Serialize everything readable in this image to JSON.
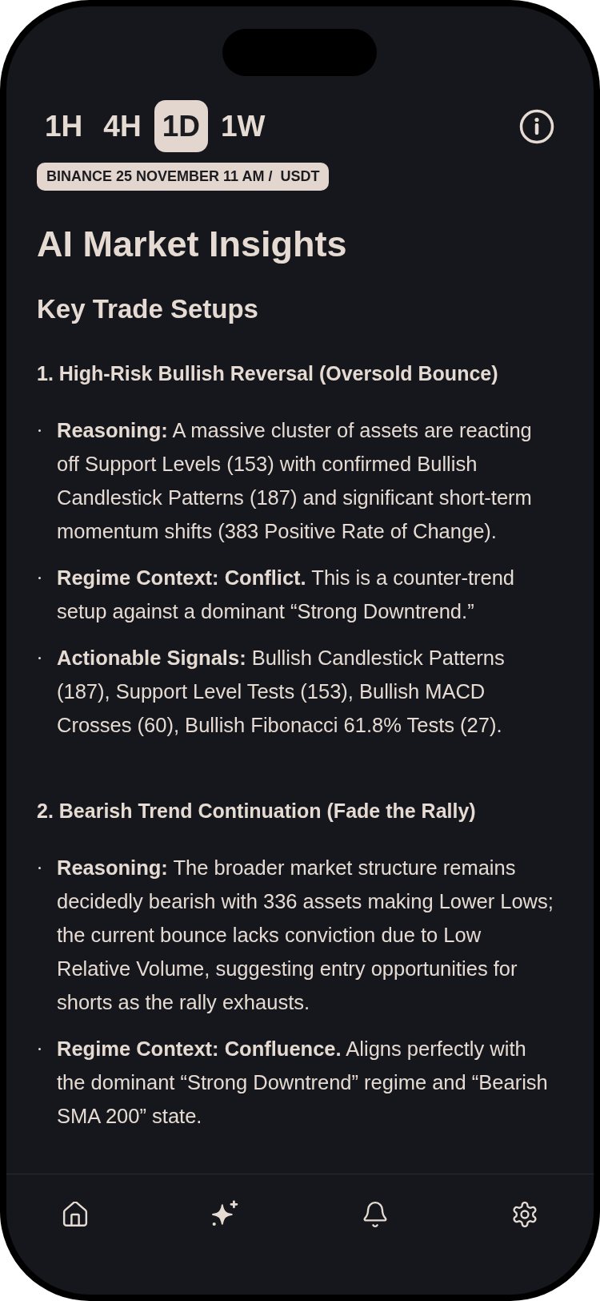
{
  "timeframe_tabs": [
    {
      "label": "1H",
      "selected": false
    },
    {
      "label": "4H",
      "selected": false
    },
    {
      "label": "1D",
      "selected": true
    },
    {
      "label": "1W",
      "selected": false
    }
  ],
  "source_badge": "BINANCE 25 NOVEMBER 11 AM /  USDT",
  "title": "AI Market Insights",
  "subtitle": "Key Trade Setups",
  "setups": [
    {
      "heading": "1. High-Risk Bullish Reversal (Oversold Bounce)",
      "points": [
        "**Reasoning:** A massive cluster of assets are reacting off Support Levels (153) with confirmed Bullish Candlestick Patterns (187) and significant short-term momentum shifts (383 Positive Rate of Change).",
        "**Regime Context: Conflict.** This is a counter-trend setup against a dominant “Strong Downtrend.”",
        "**Actionable Signals:** Bullish Candlestick Patterns (187), Support Level Tests (153), Bullish MACD Crosses (60), Bullish Fibonacci 61.8% Tests (27)."
      ]
    },
    {
      "heading": "2. Bearish Trend Continuation (Fade the Rally)",
      "points": [
        "**Reasoning:** The broader market structure remains decidedly bearish with 336 assets making Lower Lows; the current bounce lacks conviction due to Low Relative Volume, suggesting entry opportunities for shorts as the rally exhausts.",
        "**Regime Context: Confluence.** Aligns perfectly with the dominant “Strong Downtrend” regime and “Bearish SMA 200” state."
      ]
    }
  ]
}
